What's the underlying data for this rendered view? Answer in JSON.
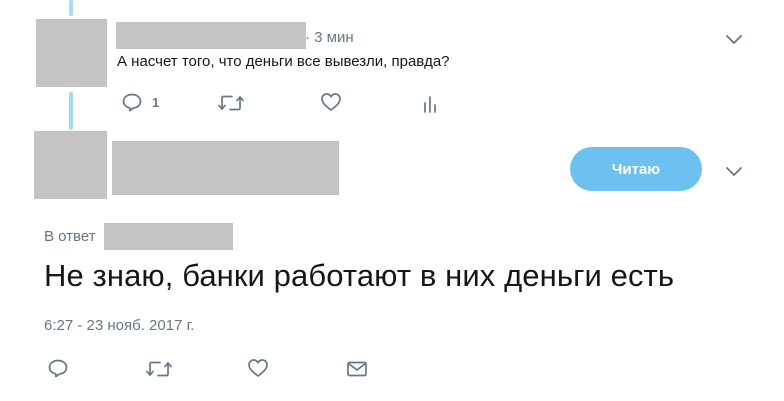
{
  "reply_tweet": {
    "time": "· 3 мин",
    "text": "А насчет того, что деньги все вывезли, правда?",
    "reply_count": "1",
    "icons": [
      "reply-icon",
      "retweet-icon",
      "like-icon",
      "analytics-icon",
      "chevron-down-icon"
    ]
  },
  "main_tweet": {
    "follow_label": "Читаю",
    "reply_to_label": "В ответ",
    "text": "Не знаю, банки работают в них деньги есть",
    "timestamp": "6:27 - 23 нояб. 2017 г.",
    "icons": [
      "reply-icon",
      "retweet-icon",
      "like-icon",
      "mail-icon",
      "chevron-down-icon"
    ]
  },
  "colors": {
    "accent": "#6cc1f0",
    "thread_line": "#a6d8f8",
    "muted_text": "#657786",
    "redaction": "#c4c4c4"
  }
}
